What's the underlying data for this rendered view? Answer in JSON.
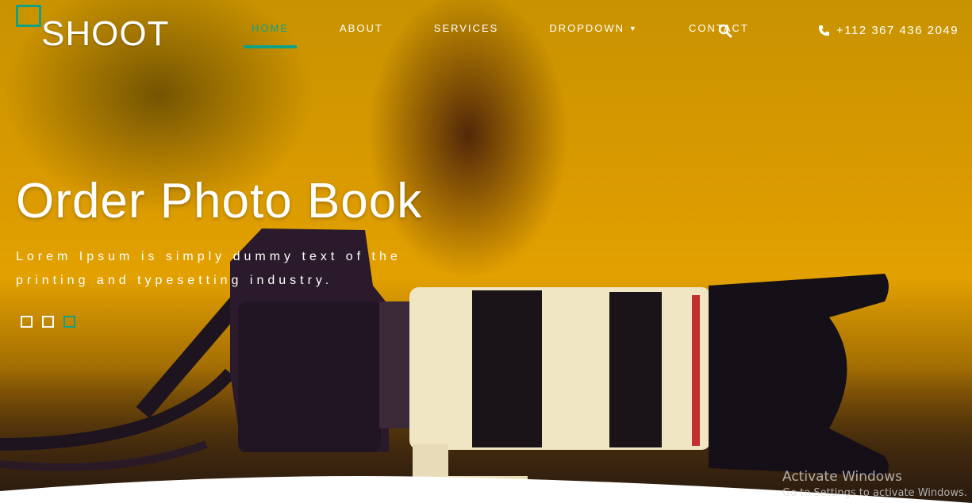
{
  "brand": {
    "name": "SHOOT"
  },
  "nav": {
    "items": [
      {
        "label": "HOME",
        "active": true
      },
      {
        "label": "ABOUT"
      },
      {
        "label": "SERVICES"
      },
      {
        "label": "DROPDOWN",
        "has_caret": true
      },
      {
        "label": "CONTACT"
      }
    ]
  },
  "header": {
    "search_icon": "search-icon",
    "phone_icon": "phone-icon",
    "phone": "+112 367 436 2049"
  },
  "hero": {
    "title": "Order Photo Book",
    "subtitle": "Lorem Ipsum is simply dummy text of the printing and typesetting industry.",
    "slides": {
      "count": 3,
      "active_index": 2
    }
  },
  "watermark": {
    "line1": "Activate Windows",
    "line2": "Go to Settings to activate Windows."
  },
  "colors": {
    "accent": "#12a187",
    "background": "#e3a100",
    "text": "#ffffff"
  }
}
